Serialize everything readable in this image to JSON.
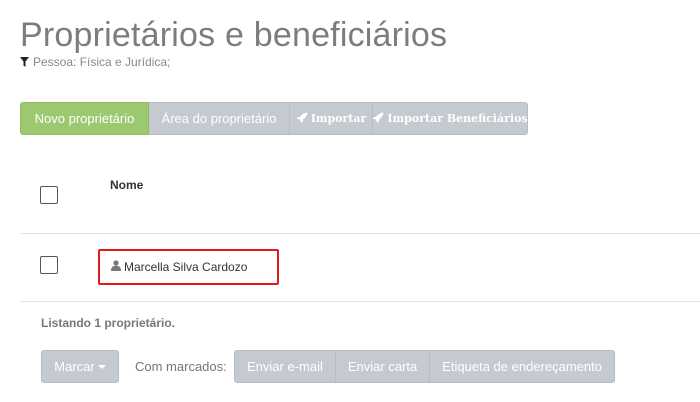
{
  "page": {
    "title": "Proprietários e beneficiários",
    "filter_text": "Pessoa: Física e Jurídica;"
  },
  "toolbar": {
    "new_owner": "Novo proprietário",
    "owner_area": "Área do proprietário",
    "import": "Importar",
    "import_beneficiaries": "Importar Beneficiários"
  },
  "table": {
    "header_name": "Nome",
    "rows": [
      {
        "name": "Marcella Silva Cardozo"
      }
    ]
  },
  "footer": {
    "listing_text": "Listando 1 proprietário.",
    "marcar_label": "Marcar",
    "with_marked_label": "Com marcados:",
    "send_email": "Enviar e-mail",
    "send_letter": "Enviar carta",
    "address_label": "Etiqueta de endereçamento"
  },
  "colors": {
    "primary_green": "#9cc970",
    "button_gray": "#c5c9d0",
    "highlight_red": "#e01b1b"
  },
  "icons": {
    "filter": "filter-icon",
    "rocket": "rocket-icon",
    "user": "user-icon",
    "caret": "caret-down-icon"
  }
}
